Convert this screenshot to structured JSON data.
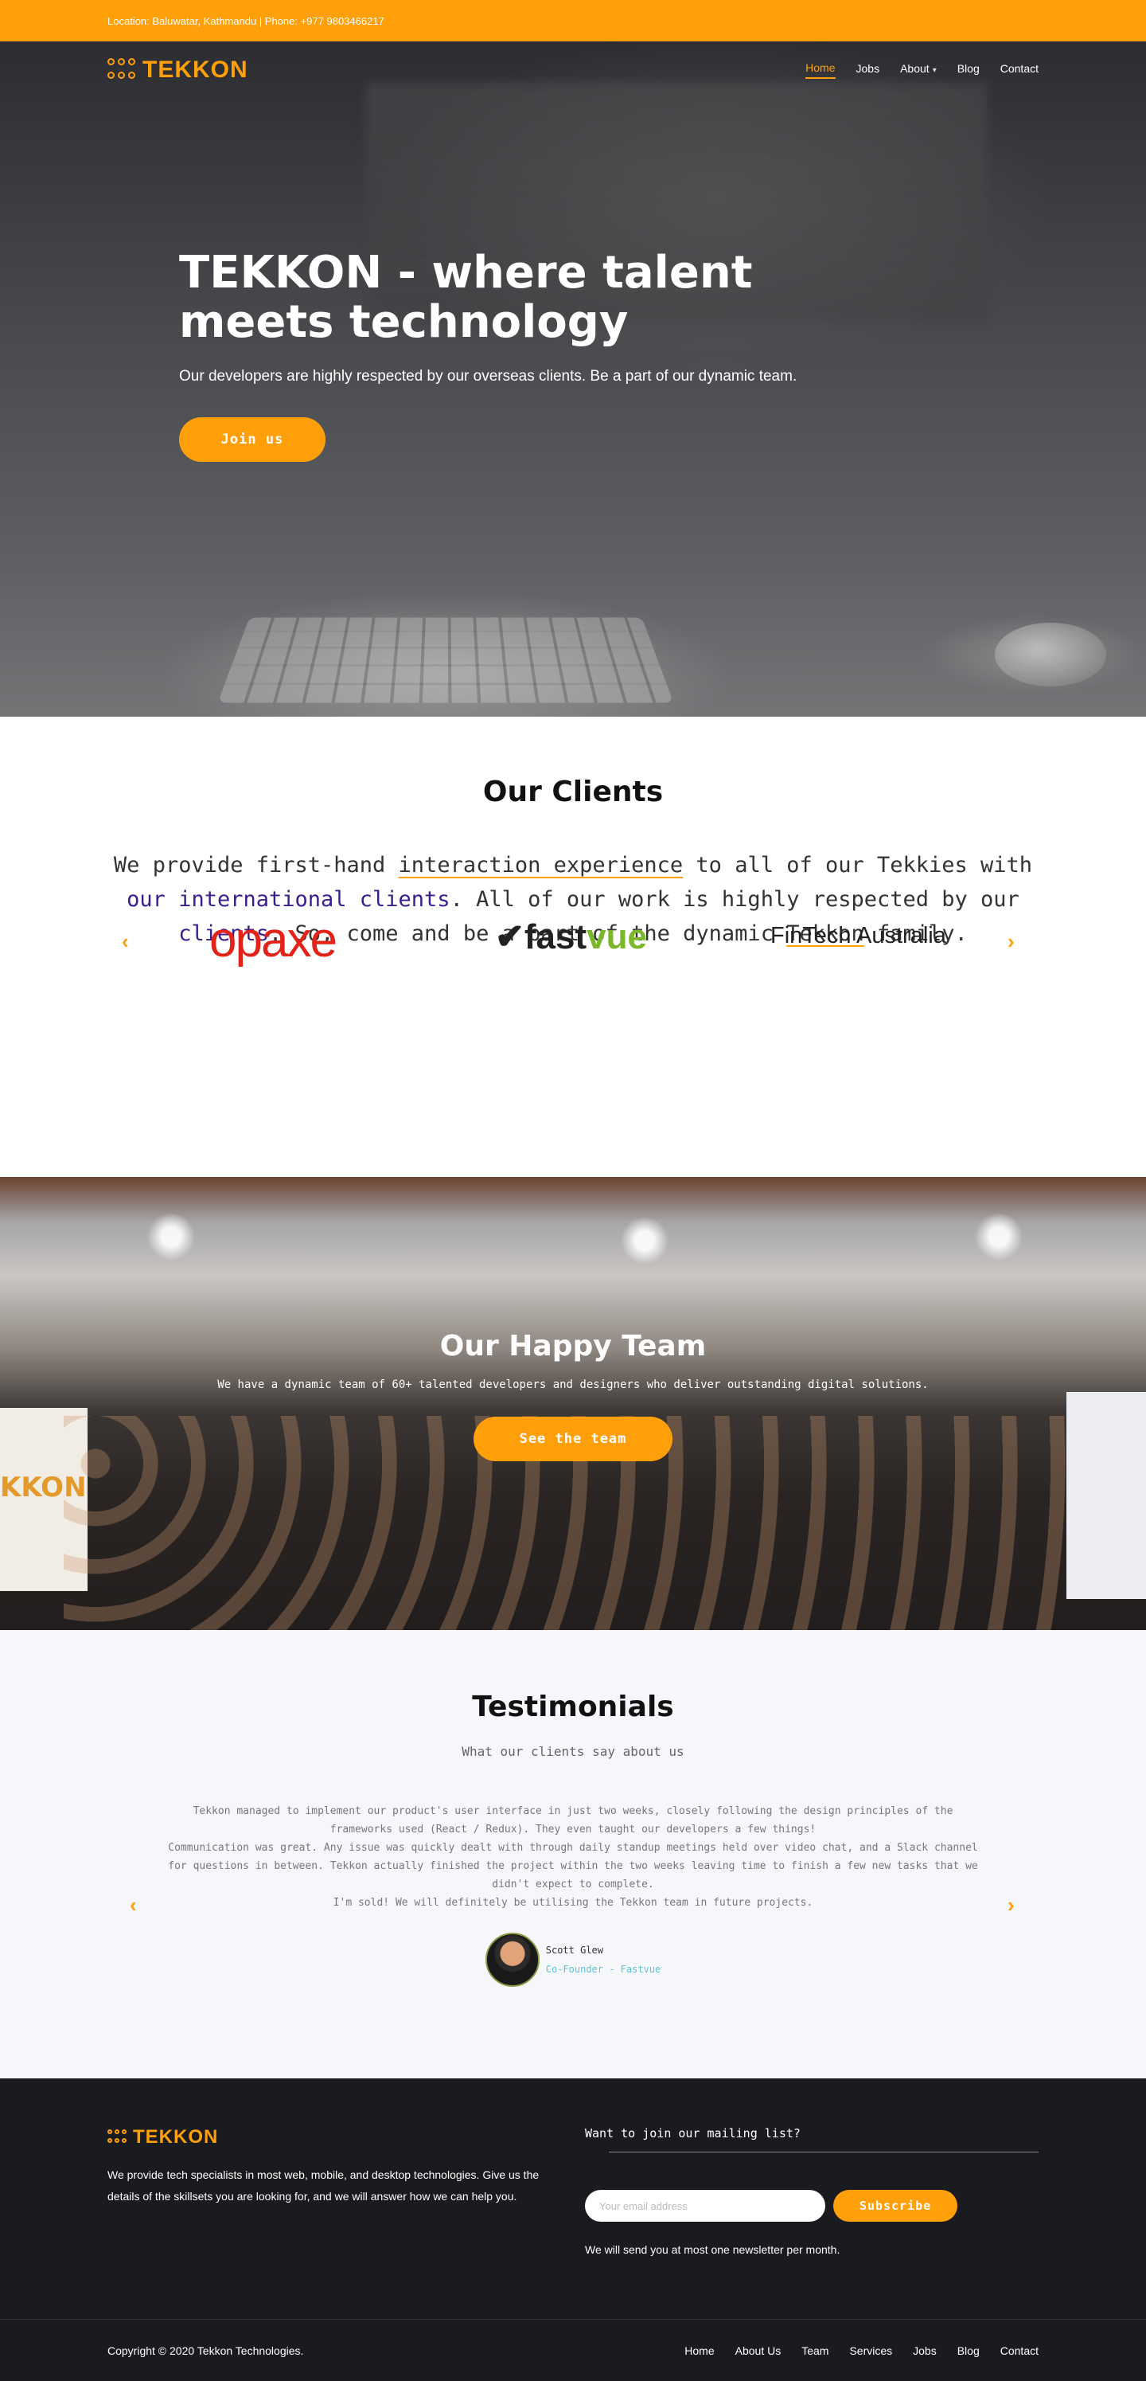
{
  "topbar": {
    "text": "Location: Baluwatar, Kathmandu | Phone: +977 9803466217"
  },
  "brand": {
    "name": "TEKKON",
    "accent": "#ff9f0a"
  },
  "nav": {
    "items": [
      {
        "label": "Home",
        "active": true
      },
      {
        "label": "Jobs",
        "active": false
      },
      {
        "label": "About",
        "active": false,
        "has_dropdown": true
      },
      {
        "label": "Blog",
        "active": false
      },
      {
        "label": "Contact",
        "active": false
      }
    ],
    "caret_icon": "chevron-down-icon"
  },
  "hero": {
    "title": "TEKKON - where talent meets technology",
    "subtitle": "Our developers are highly respected by our overseas clients. Be a part of our dynamic team.",
    "cta": "Join us"
  },
  "clients": {
    "title": "Our Clients",
    "text": {
      "p1": "We provide first-hand ",
      "u1": "interaction experience",
      "p2": " to all of our Tekkies with ",
      "b1": "our international clients",
      "p3": ". All of our work is highly respected by our ",
      "b2": "clients",
      "p4": ". So, come and be a part of the dynamic ",
      "u2": "Tekkon",
      "p5": " family."
    },
    "logos": {
      "opaxe": "opaxe",
      "fastvue_a": "fast",
      "fastvue_b": "vue",
      "fintech": "FinTech Australia"
    },
    "prev_icon": "chevron-left-icon",
    "next_icon": "chevron-right-icon",
    "arrow_prev": "‹",
    "arrow_next": "›"
  },
  "team": {
    "title": "Our Happy Team",
    "subtitle": "We have a dynamic team of 60+ talented developers and designers who deliver outstanding digital solutions.",
    "cta": "See the team",
    "banner_text": "KKON"
  },
  "testimonials": {
    "title": "Testimonials",
    "subtitle": "What our clients say about us",
    "quote": [
      "Tekkon managed to implement our product's user interface in just two weeks, closely following the design principles of the frameworks used (React / Redux). They even taught our developers a few things!",
      "Communication was great. Any issue was quickly dealt with through daily standup meetings held over video chat, and a Slack channel for questions in between. Tekkon actually finished the project within the two weeks leaving time to finish a few new tasks that we didn't expect to complete.",
      "I'm sold! We will definitely be utilising the Tekkon team in future projects."
    ],
    "author": {
      "name": "Scott Glew",
      "role": "Co-Founder - Fastvue"
    },
    "arrow_prev": "‹",
    "arrow_next": "›"
  },
  "footer": {
    "description": "We provide tech specialists in most web, mobile, and desktop technologies. Give us the details of the skillsets you are looking for, and we will answer how we can help you.",
    "mailing_title": "Want to join our mailing list?",
    "email_placeholder": "Your email address",
    "subscribe": "Subscribe",
    "note": "We will send you at most one newsletter per month.",
    "copyright": "Copyright © 2020 Tekkon Technologies.",
    "links": [
      "Home",
      "About Us",
      "Team",
      "Services",
      "Jobs",
      "Blog",
      "Contact"
    ]
  }
}
